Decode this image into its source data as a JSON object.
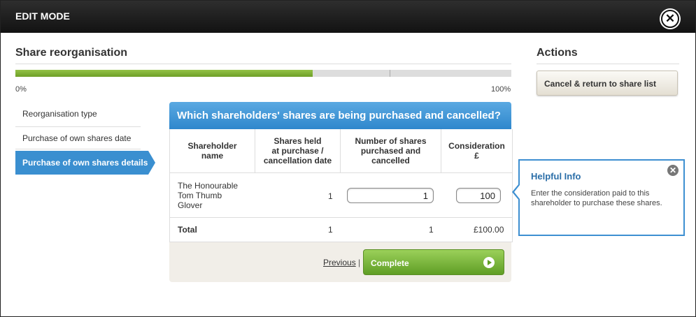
{
  "window": {
    "title": "EDIT MODE"
  },
  "wizard": {
    "heading": "Share reorganisation",
    "progress_percent": 60,
    "progress_min_label": "0%",
    "progress_max_label": "100%",
    "steps": [
      {
        "label": "Reorganisation type",
        "active": false
      },
      {
        "label": "Purchase of own shares date",
        "active": false
      },
      {
        "label": "Purchase of own shares details",
        "active": true
      }
    ]
  },
  "main": {
    "title": "Which shareholders' shares are being purchased and cancelled?",
    "columns": [
      "Shareholder\nname",
      "Shares held\nat purchase /\ncancellation date",
      "Number of shares\npurchased and\ncancelled",
      "Consideration\n£"
    ],
    "rows": [
      {
        "name": "The Honourable\nTom Thumb\nGlover",
        "shares_held": "1",
        "shares_purchased": "1",
        "consideration": "100"
      }
    ],
    "total": {
      "label": "Total",
      "shares_held": "1",
      "shares_purchased": "1",
      "consideration": "£100.00"
    },
    "previous_label": "Previous",
    "separator": "|",
    "complete_label": "Complete"
  },
  "actions": {
    "heading": "Actions",
    "cancel_label": "Cancel & return to share list"
  },
  "helpful_info": {
    "title": "Helpful Info",
    "text": "Enter the consideration paid to this shareholder to purchase these shares."
  },
  "colors": {
    "accent_blue": "#3a8fd0",
    "progress_green": "#7bb032",
    "complete_green": "#6fae2e"
  },
  "icons": {
    "close": "close-icon",
    "info_close": "close-icon",
    "complete_arrow": "arrow-right-icon"
  }
}
